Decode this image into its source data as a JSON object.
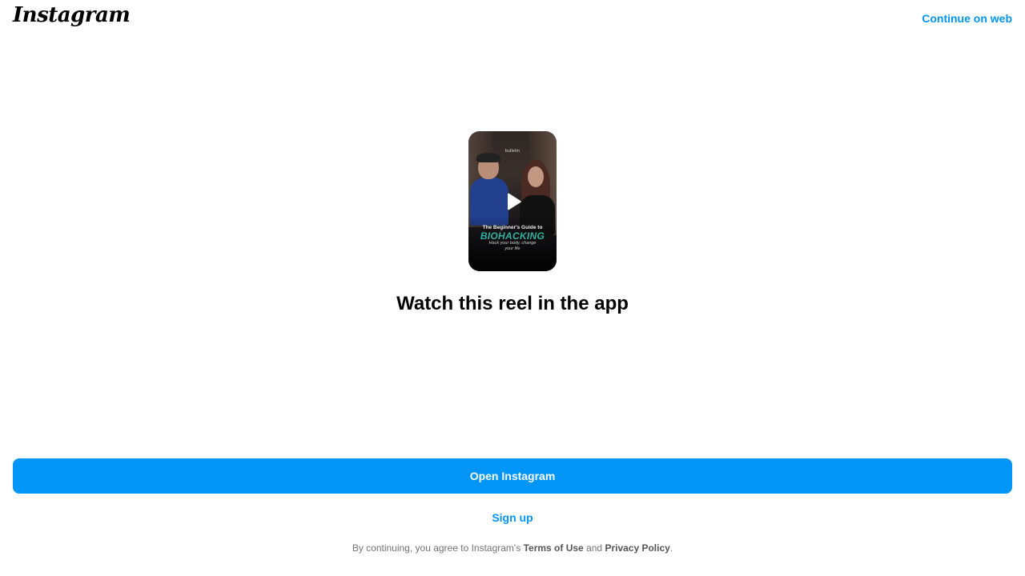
{
  "header": {
    "logo_text": "Instagram",
    "continue_label": "Continue on web"
  },
  "reel": {
    "thumbnail": {
      "brand": "bulletin",
      "guide_line": "The Beginner's Guide to",
      "title_line": "BIOHACKING",
      "sub_line": "Hack your body, change your life",
      "accent_color": "#2fb3a3"
    },
    "play_icon": "play-icon"
  },
  "main": {
    "headline": "Watch this reel in the app"
  },
  "actions": {
    "open_label": "Open Instagram",
    "signup_label": "Sign up"
  },
  "footer": {
    "prefix": "By continuing, you agree to Instagram's",
    "terms_label": "Terms of Use",
    "and_text": "and",
    "privacy_label": "Privacy Policy",
    "suffix": "."
  },
  "colors": {
    "accent": "#0095f6",
    "text": "#000000",
    "muted": "#737373"
  }
}
